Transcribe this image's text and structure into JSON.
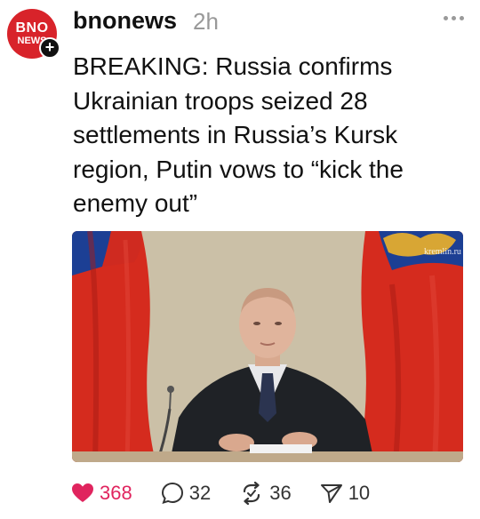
{
  "post": {
    "avatar_line1": "BNO",
    "avatar_line2": "NEWS",
    "follow_symbol": "+",
    "username": "bnonews",
    "time": "2h",
    "text": "BREAKING: Russia confirms Ukrainian troops seized 28 settlements in Russia’s Kursk region, Putin vows to “kick the enemy out”",
    "media": {
      "watermark": "kremlin.ru",
      "flag_colors": {
        "white": "#f4f4f4",
        "blue": "#1c3f94",
        "red": "#d52b1e"
      }
    },
    "actions": {
      "likes": "368",
      "comments": "32",
      "reposts": "36",
      "shares": "10",
      "like_color": "#e0245e"
    }
  }
}
